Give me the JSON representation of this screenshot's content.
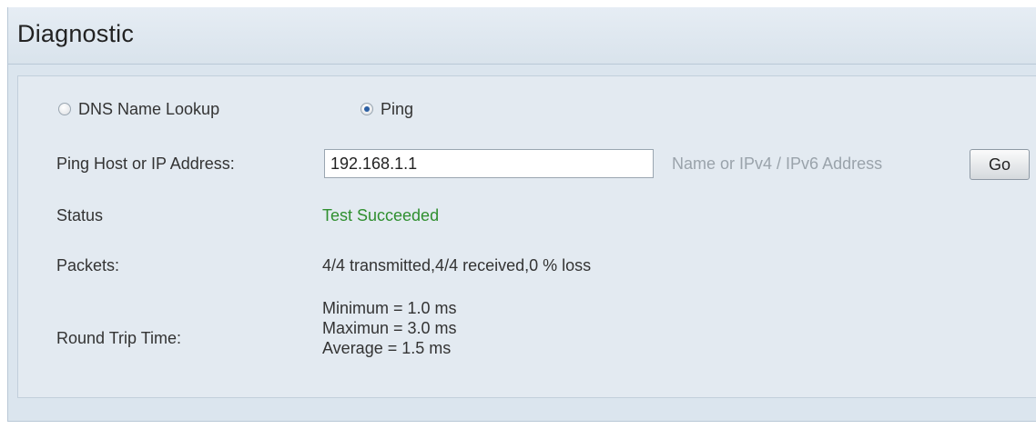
{
  "title": "Diagnostic",
  "options": {
    "dns_label": "DNS Name Lookup",
    "ping_label": "Ping"
  },
  "ping_host": {
    "label": "Ping Host or IP Address:",
    "value": "192.168.1.1",
    "hint": "Name or IPv4 / IPv6 Address",
    "go_label": "Go"
  },
  "status": {
    "label": "Status",
    "value": "Test Succeeded"
  },
  "packets": {
    "label": "Packets:",
    "value": "4/4 transmitted,4/4 received,0 % loss"
  },
  "round_trip": {
    "label": "Round Trip Time:",
    "minimum": "Minimum = 1.0 ms",
    "maximum": "Maximun = 3.0 ms",
    "average": "Average = 1.5 ms"
  },
  "colors": {
    "success": "#2f8f2f",
    "background": "#dbe5ee",
    "radio_selected": "#2c5fa3"
  }
}
